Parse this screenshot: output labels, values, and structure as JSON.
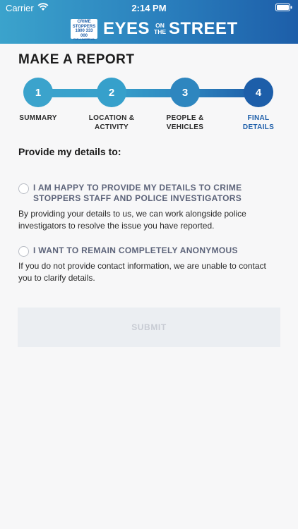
{
  "status_bar": {
    "carrier": "Carrier",
    "time": "2:14 PM"
  },
  "brand": {
    "badge_line1": "CRIME",
    "badge_line2": "STOPPERS",
    "badge_phone": "1800 333 000",
    "badge_tagline": "FOR A SAFER WA",
    "word1": "EYES",
    "on": "ON",
    "the": "THE",
    "word2": "STREET"
  },
  "page": {
    "title": "MAKE A REPORT"
  },
  "steps": [
    {
      "number": "1",
      "label": "SUMMARY",
      "active": false
    },
    {
      "number": "2",
      "label": "LOCATION &\nACTIVITY",
      "active": false
    },
    {
      "number": "3",
      "label": "PEOPLE &\nVEHICLES",
      "active": false
    },
    {
      "number": "4",
      "label": "FINAL\nDETAILS",
      "active": true
    }
  ],
  "details": {
    "heading": "Provide my details to:",
    "options": [
      {
        "label": "I AM HAPPY TO PROVIDE MY DETAILS TO CRIME STOPPERS STAFF AND POLICE INVESTIGATORS",
        "description": "By providing your details to us, we can work alongside police investigators to resolve the issue you have reported.",
        "selected": false
      },
      {
        "label": "I WANT TO REMAIN COMPLETELY ANONYMOUS",
        "description": "If you do not provide contact information, we are unable to contact you to clarify details.",
        "selected": false
      }
    ]
  },
  "submit": {
    "label": "SUBMIT"
  },
  "colors": {
    "accent": "#1d5ea9",
    "step1": "#3ba3cc",
    "option_label": "#5d647a"
  }
}
